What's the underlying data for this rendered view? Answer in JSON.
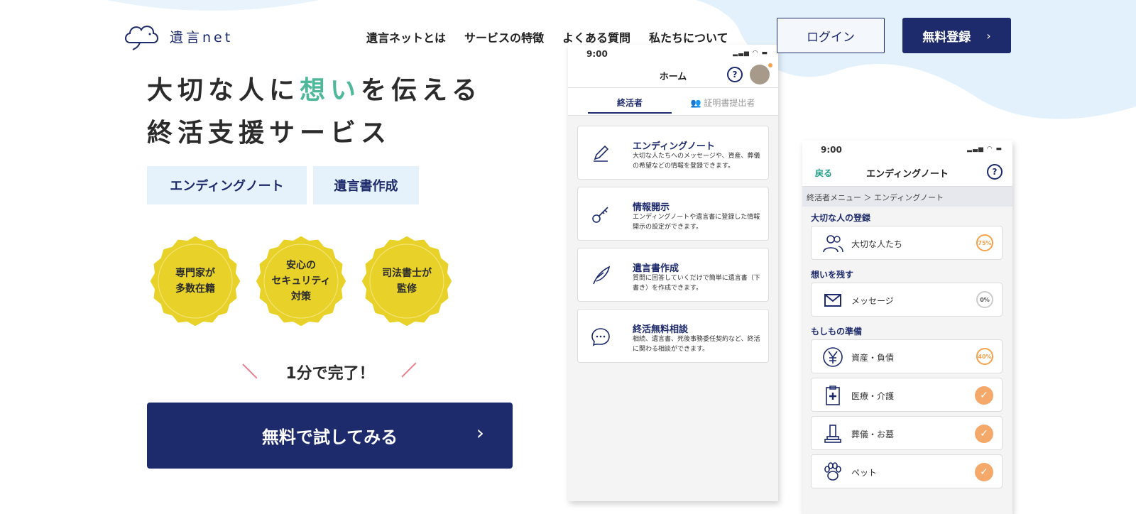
{
  "header": {
    "logo_text": "遺言net",
    "nav": [
      "遺言ネットとは",
      "サービスの特徴",
      "よくある質問",
      "私たちについて"
    ],
    "login_label": "ログイン",
    "register_label": "無料登録"
  },
  "hero": {
    "title_line1_a": "大切な人に",
    "title_line1_accent": "想い",
    "title_line1_b": "を伝える",
    "title_line2": "終活支援サービス",
    "tags": [
      "エンディングノート",
      "遺言書作成"
    ],
    "badges": [
      "専門家が\n多数在籍",
      "安心の\nセキュリティ\n対策",
      "司法書士が\n監修"
    ],
    "one_minute": "1分で完了！",
    "cta_label": "無料で試してみる"
  },
  "phone1": {
    "time": "9:00",
    "title": "ホーム",
    "tab_active": "終活者",
    "tab_inactive": "証明書提出者",
    "cards": [
      {
        "title": "エンディングノート",
        "desc": "大切な人たちへのメッセージや、資産、葬儀の希望などの情報を登録できます。"
      },
      {
        "title": "情報開示",
        "desc": "エンディングノートや遺言書に登録した情報開示の設定ができます。"
      },
      {
        "title": "遺言書作成",
        "desc": "質問に回答していくだけで簡単に遺言書（下書き）を作成できます。"
      },
      {
        "title": "終活無料相談",
        "desc": "相続、遺言書、死後事務委任契約など、終活に関わる相談ができます。"
      }
    ]
  },
  "phone2": {
    "time": "9:00",
    "back": "戻る",
    "title": "エンディングノート",
    "breadcrumb": "終活者メニュー ＞ エンディングノート",
    "sections": [
      "大切な人の登録",
      "想いを残す",
      "もしもの準備"
    ],
    "rows": [
      {
        "label": "大切な人たち",
        "status": "75%"
      },
      {
        "label": "メッセージ",
        "status": "0%"
      },
      {
        "label": "資産・負債",
        "status": "40%"
      },
      {
        "label": "医療・介護",
        "status": "check"
      },
      {
        "label": "葬儀・お墓",
        "status": "check"
      },
      {
        "label": "ペット",
        "status": "check"
      }
    ]
  },
  "colors": {
    "navy": "#1d2a6b",
    "accent_green": "#4fb89a",
    "badge_yellow": "#e8d22a",
    "progress_orange": "#f4a24b",
    "tag_bg": "#e6f2fb"
  }
}
